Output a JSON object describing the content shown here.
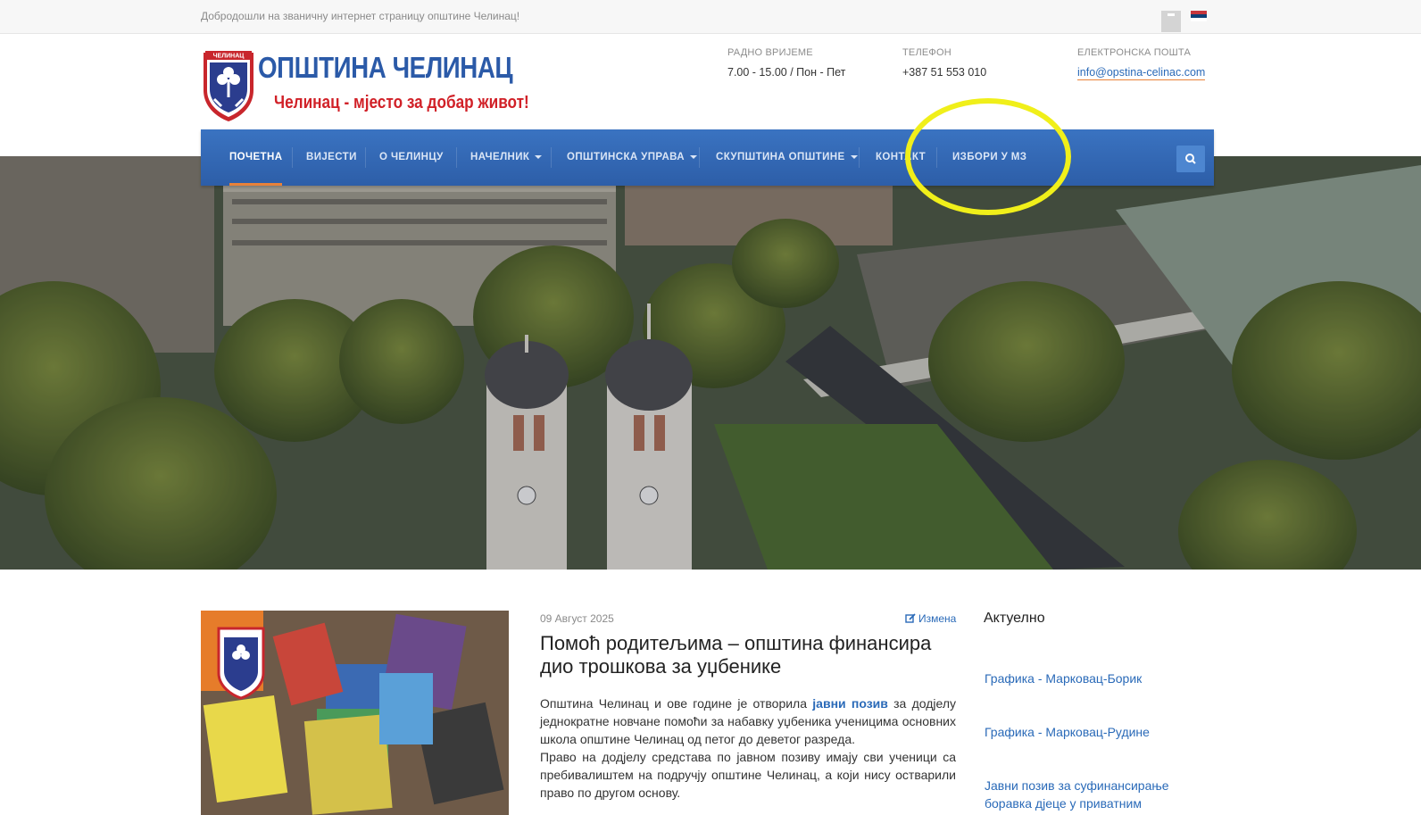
{
  "topbar": {
    "welcome": "Добродошли на званичну интернет страницу општине Челинац!"
  },
  "colors": {
    "nav_bg": "#2d5ea8",
    "accent_orange": "#e8823a",
    "link_blue": "#2a6ab8",
    "brand_red": "#d12128",
    "highlight_yellow": "#f0ef1a"
  },
  "header": {
    "logo_crest_label": "ЧЕЛИНАЦ",
    "logo_title": "ОПШТИНА ЧЕЛИНАЦ",
    "logo_subtitle": "Челинац - мјесто за добар живот!",
    "hours_label": "РАДНО ВРИЈЕМЕ",
    "hours_value": "7.00 - 15.00 / Пон - Пет",
    "phone_label": "ТЕЛЕФОН",
    "phone_value": "+387 51 553 010",
    "email_label": "ЕЛЕКТРОНСКА ПОШТА",
    "email_value": "info@opstina-celinac.com"
  },
  "nav": {
    "items": [
      {
        "label": "ПОЧЕТНА",
        "active": true
      },
      {
        "label": "ВИЈЕСТИ"
      },
      {
        "label": "О ЧЕЛИНЦУ"
      },
      {
        "label": "НАЧЕЛНИК",
        "dropdown": true
      },
      {
        "label": "ОПШТИНСКА УПРАВА",
        "dropdown": true
      },
      {
        "label": "СКУПШТИНА ОПШТИНЕ",
        "dropdown": true
      },
      {
        "label": "КОНТАКТ"
      },
      {
        "label": "ИЗБОРИ У МЗ"
      }
    ],
    "search_icon": "search-icon"
  },
  "article": {
    "date": "09 Август 2025",
    "edit_label": "Измена",
    "title": "Помоћ родитељима – општина финансира дио трошкова за уџбенике",
    "p1_before": "Општина Челинац и ове године је отворила ",
    "p1_link": "јавни позив",
    "p1_after": " за додјелу једнократне новчане помоћи за набавку уџбеника ученицима основних школа општине Челинац од петог до деветог разреда.",
    "p2": "Право на додјелу средстава по јавном позиву имају сви ученици са пребивалиштем на подручју општине Челинац, а који нису остварили право по другом основу."
  },
  "sidebar": {
    "heading": "Актуелно",
    "links": [
      "Графика - Марковац-Борик",
      "Графика - Марковац-Рудине",
      "Јавни позив за суфинансирање боравка дјеце у приватним"
    ]
  }
}
